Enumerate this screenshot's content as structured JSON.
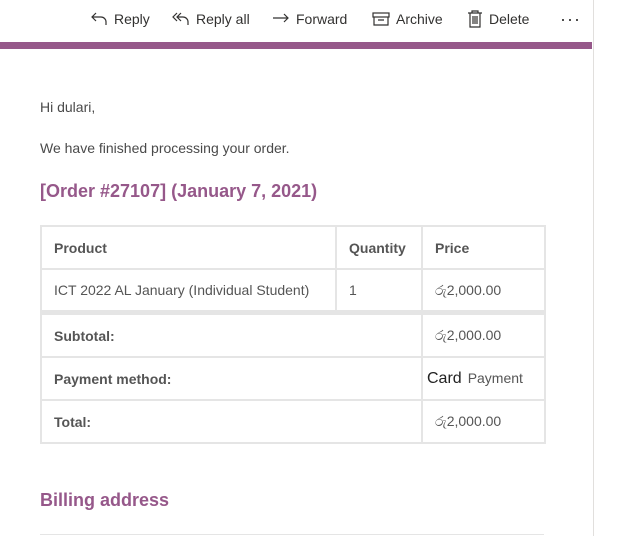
{
  "toolbar": {
    "reply": {
      "label": "Reply",
      "icon": "reply-icon"
    },
    "reply_all": {
      "label": "Reply all",
      "icon": "reply-all-icon"
    },
    "forward": {
      "label": "Forward",
      "icon": "forward-icon"
    },
    "archive": {
      "label": "Archive",
      "icon": "archive-icon"
    },
    "delete": {
      "label": "Delete",
      "icon": "trash-icon"
    },
    "more": {
      "label": "···",
      "icon": "more-icon"
    }
  },
  "colors": {
    "accent": "#96588a",
    "border": "#e5e5e5",
    "text": "#555555"
  },
  "email": {
    "greeting": "Hi dulari,",
    "intro": "We have finished processing your order.",
    "order_title": "[Order #27107] (January 7, 2021)",
    "table": {
      "headers": {
        "product": "Product",
        "quantity": "Quantity",
        "price": "Price"
      },
      "items": [
        {
          "product": "ICT 2022 AL January (Individual Student)",
          "quantity": "1",
          "price": "රු2,000.00"
        }
      ],
      "totals": {
        "subtotal_label": "Subtotal:",
        "subtotal_value": "රු2,000.00",
        "payment_label": "Payment method:",
        "payment_value_card": "Card",
        "payment_value_payment": "Payment",
        "total_label": "Total:",
        "total_value": "රු2,000.00"
      }
    },
    "billing_title": "Billing address"
  }
}
